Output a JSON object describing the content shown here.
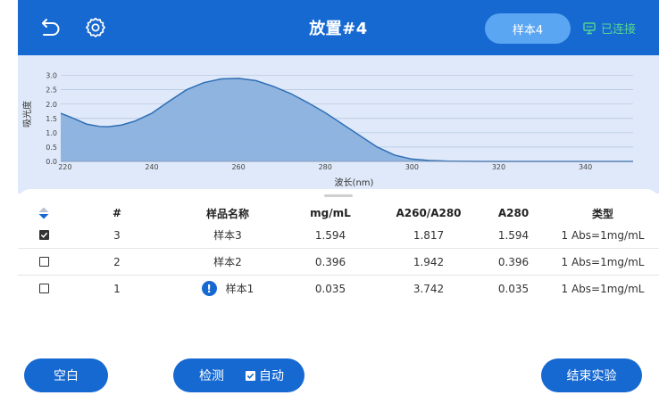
{
  "header": {
    "title": "放置#4",
    "sample_button": "样本4",
    "connection_status": "已连接",
    "icons": [
      "back-icon",
      "gear-icon",
      "connection-icon"
    ],
    "colors": {
      "bar": "#1769d2",
      "pill": "#5aa6f3",
      "connected": "#54d58f"
    }
  },
  "chart_data": {
    "type": "area",
    "title": "",
    "xlabel": "波长(nm)",
    "ylabel": "吸光度",
    "xlim": [
      219,
      351
    ],
    "ylim": [
      0,
      3.3
    ],
    "xticks": [
      220,
      240,
      260,
      280,
      300,
      320,
      340
    ],
    "yticks": [
      0.0,
      0.5,
      1.0,
      1.5,
      2.0,
      2.5,
      3.0
    ],
    "ytick_labels": [
      "0.0",
      "0.5",
      "1.0",
      "1.5",
      "2.0",
      "2.5",
      "3.0"
    ],
    "grid": true,
    "series": [
      {
        "x": [
          219,
          222,
          225,
          228,
          230,
          233,
          236,
          240,
          244,
          248,
          252,
          256,
          260,
          264,
          268,
          272,
          276,
          280,
          284,
          288,
          292,
          296,
          300,
          304,
          308,
          312,
          316,
          320,
          330,
          340,
          351
        ],
        "y": [
          1.68,
          1.5,
          1.3,
          1.22,
          1.21,
          1.27,
          1.4,
          1.68,
          2.1,
          2.5,
          2.75,
          2.88,
          2.9,
          2.82,
          2.62,
          2.37,
          2.05,
          1.7,
          1.3,
          0.9,
          0.5,
          0.22,
          0.08,
          0.03,
          0.01,
          0.005,
          0,
          0,
          0,
          0,
          0
        ],
        "color": "#2f6fb5",
        "fill": "#8ab1de"
      }
    ]
  },
  "table": {
    "columns": [
      "#",
      "样品名称",
      "mg/mL",
      "A260/A280",
      "A280",
      "类型"
    ],
    "rows": [
      {
        "checked": true,
        "num": "3",
        "name": "样本3",
        "warning": false,
        "mg": "1.594",
        "ratio": "1.817",
        "a280": "1.594",
        "type": "1 Abs=1mg/mL"
      },
      {
        "checked": false,
        "num": "2",
        "name": "样本2",
        "warning": false,
        "mg": "0.396",
        "ratio": "1.942",
        "a280": "0.396",
        "type": "1 Abs=1mg/mL"
      },
      {
        "checked": false,
        "num": "1",
        "name": "样本1",
        "warning": true,
        "warning_glyph": "!",
        "mg": "0.035",
        "ratio": "3.742",
        "a280": "0.035",
        "type": "1 Abs=1mg/mL"
      }
    ]
  },
  "buttons": {
    "blank": "空白",
    "detect": "检测",
    "auto": "自动",
    "auto_checked": true,
    "end": "结束实验"
  }
}
